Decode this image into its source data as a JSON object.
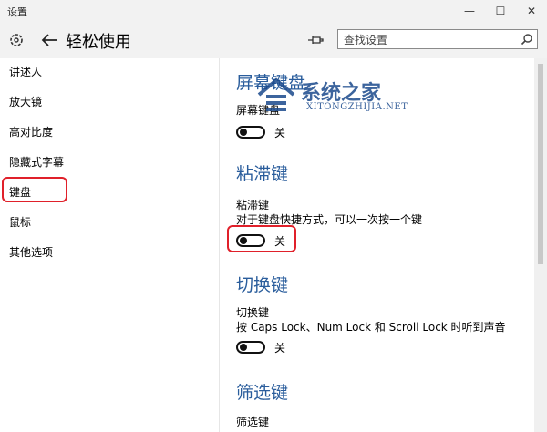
{
  "window": {
    "title": "设置",
    "minimize_glyph": "—",
    "maximize_glyph": "☐",
    "close_glyph": "✕"
  },
  "header": {
    "page_title": "轻松使用",
    "back_icon": "back-arrow-icon",
    "home_icon": "settings-gear-icon",
    "pin_icon": "pin-icon"
  },
  "search": {
    "placeholder": "查找设置",
    "icon": "search-icon"
  },
  "sidebar": {
    "items": [
      {
        "label": "讲述人"
      },
      {
        "label": "放大镜"
      },
      {
        "label": "高对比度"
      },
      {
        "label": "隐藏式字幕"
      },
      {
        "label": "键盘",
        "selected": true
      },
      {
        "label": "鼠标"
      },
      {
        "label": "其他选项"
      }
    ]
  },
  "sections": [
    {
      "title": "屏幕键盘",
      "setting": "屏幕键盘",
      "description": "",
      "toggle_label": "关",
      "toggle_on": false
    },
    {
      "title": "粘滞键",
      "setting": "粘滞键",
      "description": "对于键盘快捷方式，可以一次按一个键",
      "toggle_label": "关",
      "toggle_on": false
    },
    {
      "title": "切换键",
      "setting": "切换键",
      "description": "按 Caps Lock、Num Lock 和 Scroll Lock 时听到声音",
      "toggle_label": "关",
      "toggle_on": false
    },
    {
      "title": "筛选键",
      "setting": "筛选键",
      "description": "",
      "toggle_label": "",
      "toggle_on": false
    }
  ],
  "watermark": {
    "chinese": "系统之家",
    "english": "XITONGZHIJIA.NET"
  },
  "colors": {
    "accent": "#2a5d9c",
    "highlight": "#e0202a",
    "chrome": "#f2f2f2"
  }
}
